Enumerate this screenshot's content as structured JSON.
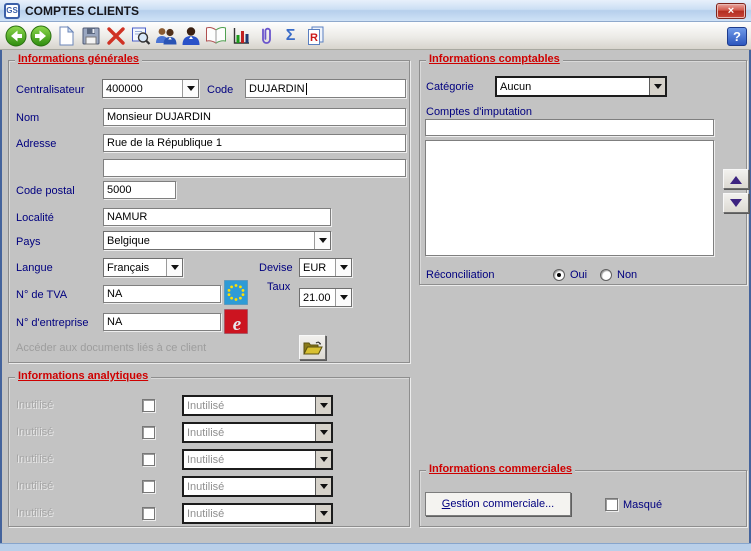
{
  "window": {
    "title": "COMPTES CLIENTS",
    "app_icon_text": "GS",
    "close_glyph": "×"
  },
  "toolbar": {
    "icons": [
      "nav-back",
      "nav-forward",
      "new-document",
      "save",
      "delete",
      "search",
      "clients",
      "client",
      "book",
      "chart",
      "attachment",
      "sum",
      "report"
    ],
    "sigma_glyph": "Σ",
    "report_glyph": "R",
    "help_label": "?"
  },
  "general": {
    "title": "Informations générales",
    "centralisateur_label": "Centralisateur",
    "centralisateur_value": "400000",
    "code_label": "Code",
    "code_value": "DUJARDIN",
    "nom_label": "Nom",
    "nom_value": "Monsieur DUJARDIN",
    "adresse_label": "Adresse",
    "adresse_value": "Rue de la République 1",
    "adresse2_value": "",
    "code_postal_label": "Code postal",
    "code_postal_value": "5000",
    "localite_label": "Localité",
    "localite_value": "NAMUR",
    "pays_label": "Pays",
    "pays_value": "Belgique",
    "langue_label": "Langue",
    "langue_value": "Français",
    "devise_label": "Devise",
    "devise_value": "EUR",
    "tva_label": "N° de TVA",
    "tva_value": "NA",
    "taux_label": "Taux",
    "taux_value": "21.00",
    "entreprise_label": "N° d'entreprise",
    "entreprise_value": "NA",
    "enterprise_glyph": "e",
    "documents_link": "Accéder aux documents liés à ce client"
  },
  "analytics": {
    "title": "Informations analytiques",
    "rows": [
      {
        "label": "Inutilisé",
        "value": "Inutilisé",
        "checked": false
      },
      {
        "label": "Inutilisé",
        "value": "Inutilisé",
        "checked": false
      },
      {
        "label": "Inutilisé",
        "value": "Inutilisé",
        "checked": false
      },
      {
        "label": "Inutilisé",
        "value": "Inutilisé",
        "checked": false
      },
      {
        "label": "Inutilisé",
        "value": "Inutilisé",
        "checked": false
      }
    ]
  },
  "accounting": {
    "title": "Informations comptables",
    "categorie_label": "Catégorie",
    "categorie_value": "Aucun",
    "comptes_label": "Comptes d'imputation",
    "comptes_value": "",
    "reconciliation_label": "Réconciliation",
    "oui_label": "Oui",
    "non_label": "Non",
    "selected_option": "Oui"
  },
  "commercial": {
    "title": "Informations commerciales",
    "gestion_mnemonic": "G",
    "gestion_rest": "estion commerciale...",
    "masque_label": "Masqué",
    "masque_checked": false
  },
  "colors": {
    "header_red": "#cf0000",
    "label_navy": "#00007f",
    "background_gray": "#c3c3c3",
    "titlebar_blue": "#cbdff4",
    "close_red": "#b22d20",
    "help_blue": "#2d57be",
    "eu_flag_blue": "#2e9bd6",
    "enterprise_red": "#cc1420",
    "arrow_purple": "#3d2480"
  }
}
